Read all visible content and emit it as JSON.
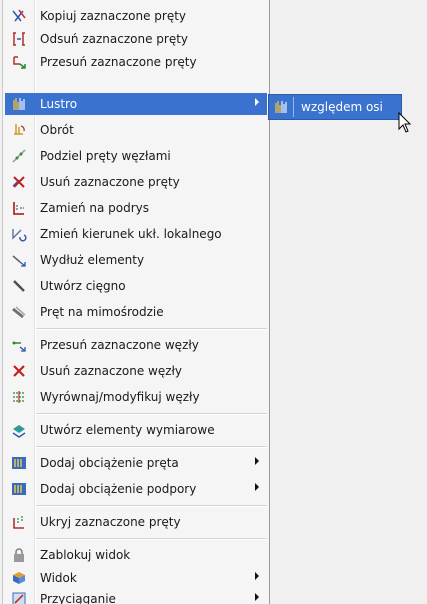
{
  "menu": {
    "items": [
      {
        "label": "Kopiuj zaznaczone pręty",
        "icon": "copy-bars-icon"
      },
      {
        "label": "Odsuń zaznaczone pręty",
        "icon": "offset-bars-icon"
      },
      {
        "label": "Przesuń zaznaczone pręty",
        "icon": "move-bars-icon"
      },
      {
        "label": "Lustro",
        "icon": "mirror-icon",
        "has_submenu": true,
        "selected": true
      },
      {
        "label": "Obrót",
        "icon": "rotate-icon"
      },
      {
        "label": "Podziel pręty węzłami",
        "icon": "divide-bars-icon"
      },
      {
        "label": "Usuń zaznaczone pręty",
        "icon": "delete-bars-icon"
      },
      {
        "label": "Zamień na podrys",
        "icon": "convert-to-underlay-icon"
      },
      {
        "label": "Zmień kierunek ukł. lokalnego",
        "icon": "local-axis-direction-icon"
      },
      {
        "label": "Wydłuż elementy",
        "icon": "extend-elements-icon"
      },
      {
        "label": "Utwórz cięgno",
        "icon": "create-cable-icon"
      },
      {
        "label": "Pręt na mimośrodzie",
        "icon": "eccentric-bar-icon"
      },
      {
        "label": "Przesuń zaznaczone węzły",
        "icon": "move-nodes-icon"
      },
      {
        "label": "Usuń zaznaczone węzły",
        "icon": "delete-nodes-icon"
      },
      {
        "label": "Wyrównaj/modyfikuj węzły",
        "icon": "align-nodes-icon"
      },
      {
        "label": "Utwórz elementy wymiarowe",
        "icon": "dimension-elements-icon"
      },
      {
        "label": "Dodaj obciążenie pręta",
        "icon": "bar-load-icon",
        "has_submenu": true
      },
      {
        "label": "Dodaj obciążenie podpory",
        "icon": "support-load-icon",
        "has_submenu": true
      },
      {
        "label": "Ukryj zaznaczone pręty",
        "icon": "hide-bars-icon"
      },
      {
        "label": "Zablokuj widok",
        "icon": "lock-view-icon"
      },
      {
        "label": "Widok",
        "icon": "view-icon",
        "has_submenu": true
      },
      {
        "label": "Przyciąganie",
        "icon": "snap-icon",
        "has_submenu": true
      }
    ]
  },
  "submenu": {
    "items": [
      {
        "label": "względem osi",
        "icon": "mirror-axis-icon",
        "selected": true
      }
    ]
  },
  "colors": {
    "selection": "#3a72d0",
    "menu_background": "#f5f5f5",
    "canvas_background": "#f0f0f0"
  }
}
